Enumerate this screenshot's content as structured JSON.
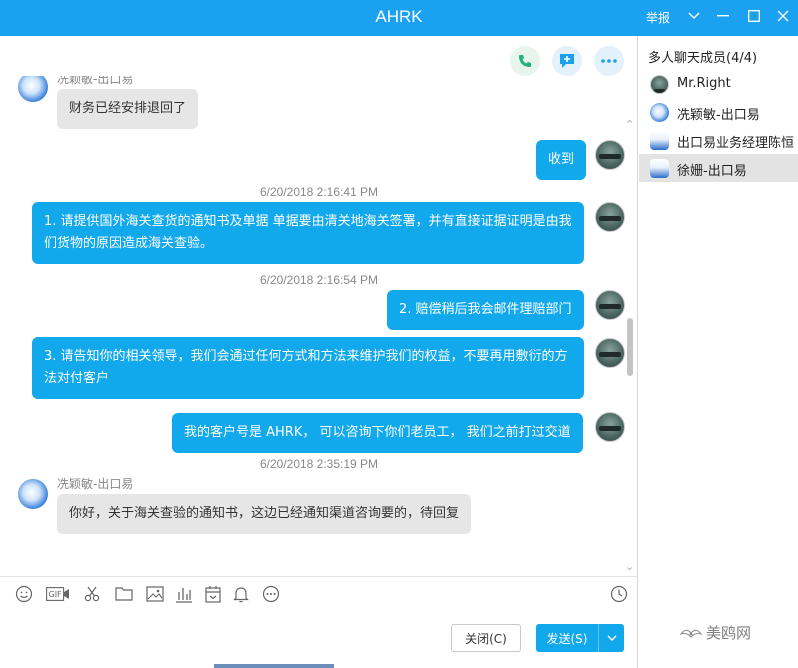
{
  "window": {
    "title": "AHRK",
    "report_label": "举报"
  },
  "chat": {
    "messages": [
      {
        "kind": "in",
        "sender": "冼颖敏-出口易",
        "text": "财务已经安排退回了"
      },
      {
        "kind": "out",
        "text": "收到"
      },
      {
        "kind": "time",
        "text": "6/20/2018 2:16:41 PM"
      },
      {
        "kind": "out",
        "text": "1.  请提供国外海关查货的通知书及单据  单据要由清关地海关签署，并有直接证据证明是由我们货物的原因造成海关查验。"
      },
      {
        "kind": "time",
        "text": "6/20/2018 2:16:54 PM"
      },
      {
        "kind": "out",
        "text": "2.  赔偿稍后我会邮件理赔部门"
      },
      {
        "kind": "out",
        "text": "3. 请告知你的相关领导，我们会通过任何方式和方法来维护我们的权益，不要再用敷衍的方法对付客户"
      },
      {
        "kind": "out",
        "text": "我的客户号是 AHRK，  可以咨询下你们老员工，  我们之前打过交道"
      },
      {
        "kind": "time",
        "text": "6/20/2018 2:35:19 PM"
      },
      {
        "kind": "in",
        "sender": "冼颖敏-出口易",
        "text": "你好，关于海关查验的通知书，这边已经通知渠道咨询要的，待回复"
      }
    ]
  },
  "actions": {
    "close_label": "关闭(C)",
    "send_label": "发送(S)"
  },
  "members": {
    "title": "多人聊天成员(4/4)",
    "items": [
      {
        "name": "Mr.Right"
      },
      {
        "name": "冼颖敏-出口易"
      },
      {
        "name": "出口易业务经理陈恒"
      },
      {
        "name": "徐姗-出口易"
      }
    ]
  },
  "watermark": "美鸥网",
  "colors": {
    "titlebar": "#1aa1f0",
    "bubble_out": "#12a8ec",
    "bubble_in": "#e6e6e6"
  }
}
